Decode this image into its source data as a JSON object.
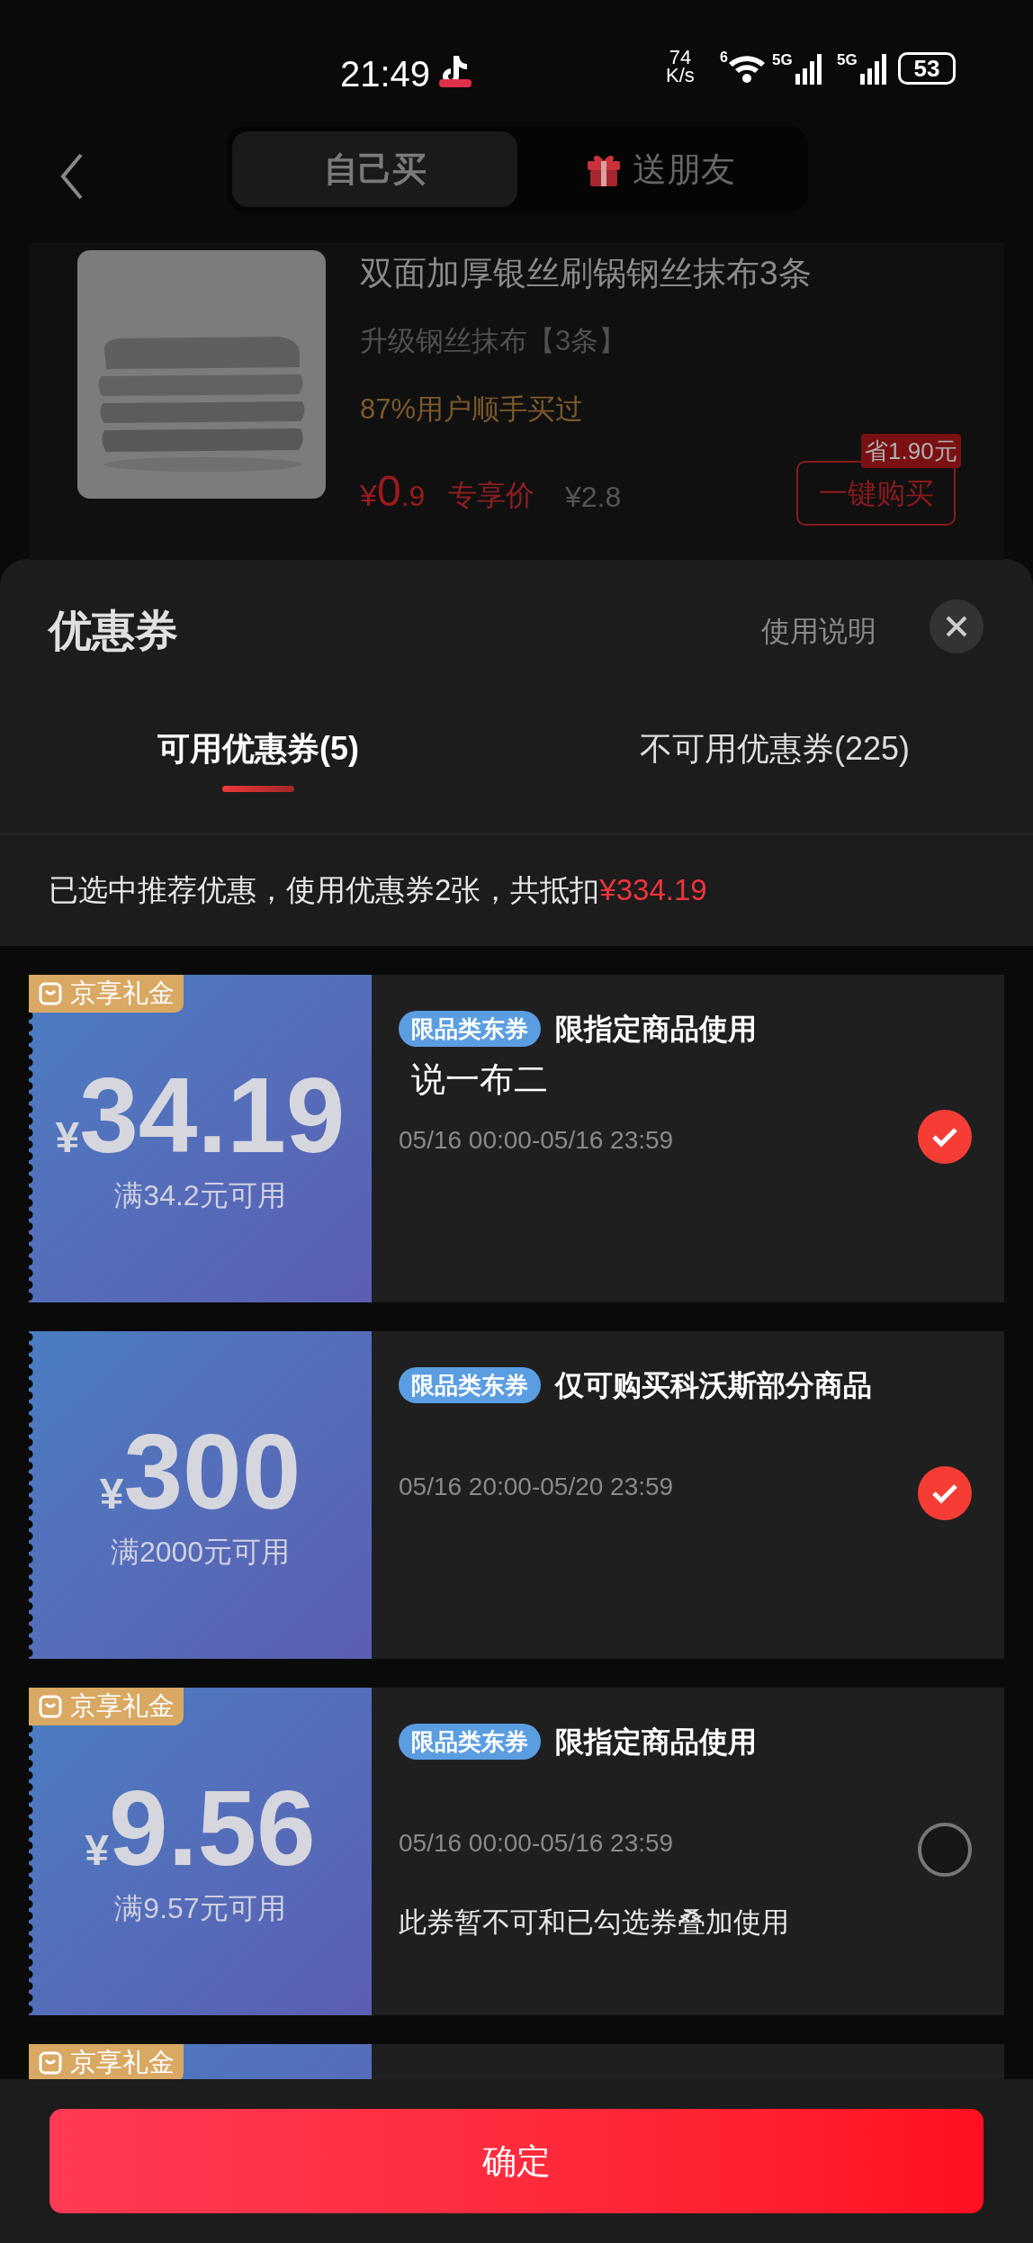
{
  "status_bar": {
    "time": "21:49",
    "speed_value": "74",
    "speed_unit": "K/s",
    "wifi_label": "6",
    "sim1": "5G",
    "sim2": "5G",
    "battery": "53"
  },
  "header": {
    "segments": [
      {
        "label": "自己买",
        "selected": true,
        "kind": "plain"
      },
      {
        "label": "送朋友",
        "selected": false,
        "kind": "gift"
      }
    ]
  },
  "product": {
    "title": "双面加厚银丝刷锅钢丝抹布3条",
    "variant": "升级钢丝抹布【3条】",
    "social_proof": "87%用户顺手买过",
    "currency": "¥",
    "price_int": "0",
    "price_dec": ".9",
    "price_label": "专享价",
    "original_price": "¥2.8",
    "saving": "省1.90元",
    "buy_button": "一键购买"
  },
  "sheet": {
    "title": "优惠券",
    "help_link": "使用说明",
    "tabs": [
      {
        "label": "可用优惠券(5)",
        "selected": true
      },
      {
        "label": "不可用优惠券(225)",
        "selected": false
      }
    ],
    "summary": "已选中推荐优惠，使用优惠券2张，共抵扣",
    "summary_amount": "¥334.19",
    "coupons": [
      {
        "gift_tag": "京享礼金",
        "currency": "¥",
        "amount": "34.19",
        "condition": "满34.2元可用",
        "badge": "限品类东券",
        "title": "限指定商品使用",
        "subtitle": "说一布二",
        "period": "05/16 00:00-05/16 23:59",
        "selected": true
      },
      {
        "currency": "¥",
        "amount": "300",
        "condition": "满2000元可用",
        "badge": "限品类东券",
        "title": "仅可购买科沃斯部分商品",
        "period": "05/16 20:00-05/20 23:59",
        "selected": true
      },
      {
        "gift_tag": "京享礼金",
        "currency": "¥",
        "amount": "9.56",
        "condition": "满9.57元可用",
        "badge": "限品类东券",
        "title": "限指定商品使用",
        "period": "05/16 00:00-05/16 23:59",
        "note": "此券暂不可和已勾选券叠加使用",
        "selected": false
      },
      {
        "gift_tag": "京享礼金"
      }
    ],
    "confirm_button": "确定"
  }
}
